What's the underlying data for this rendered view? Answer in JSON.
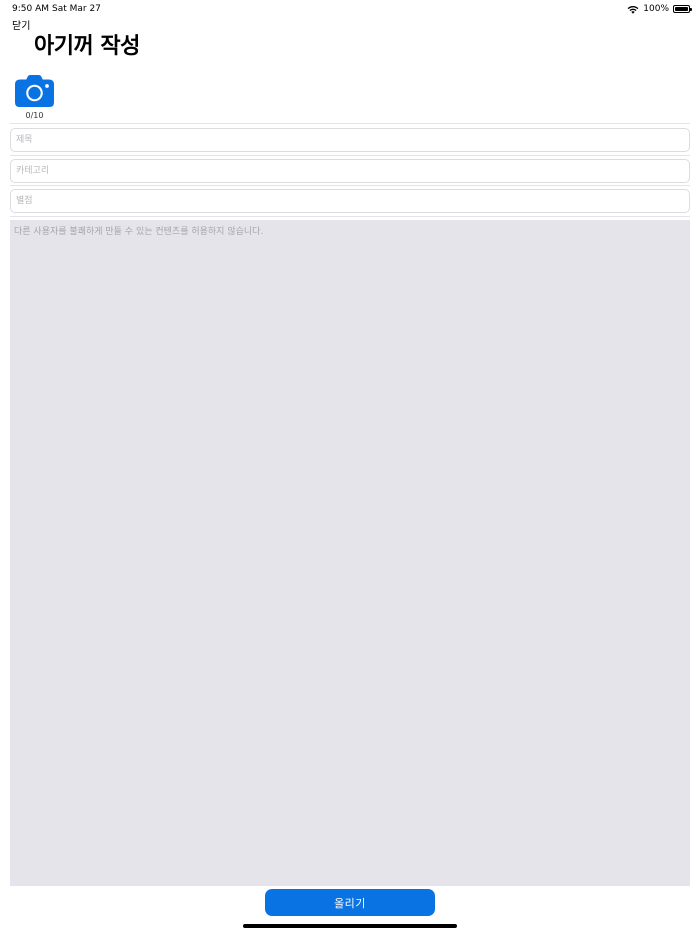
{
  "status_bar": {
    "time": "9:50 AM",
    "date": "Sat Mar 27",
    "battery": "100%",
    "icons": [
      "wifi-icon",
      "battery-icon"
    ]
  },
  "header": {
    "close_label": "닫기",
    "title": "아기꺼 작성"
  },
  "photo": {
    "icon": "camera-icon",
    "count": "0/10"
  },
  "form": {
    "title_placeholder": "제목",
    "category_placeholder": "카테고리",
    "location_placeholder": "별점",
    "content_placeholder": "다른 사용자를 불쾌하게 만들 수 있는 컨텐츠를 허용하지 않습니다."
  },
  "submit_label": "올리기",
  "colors": {
    "accent": "#0A73E4",
    "content_background": "#E5E4EA"
  }
}
